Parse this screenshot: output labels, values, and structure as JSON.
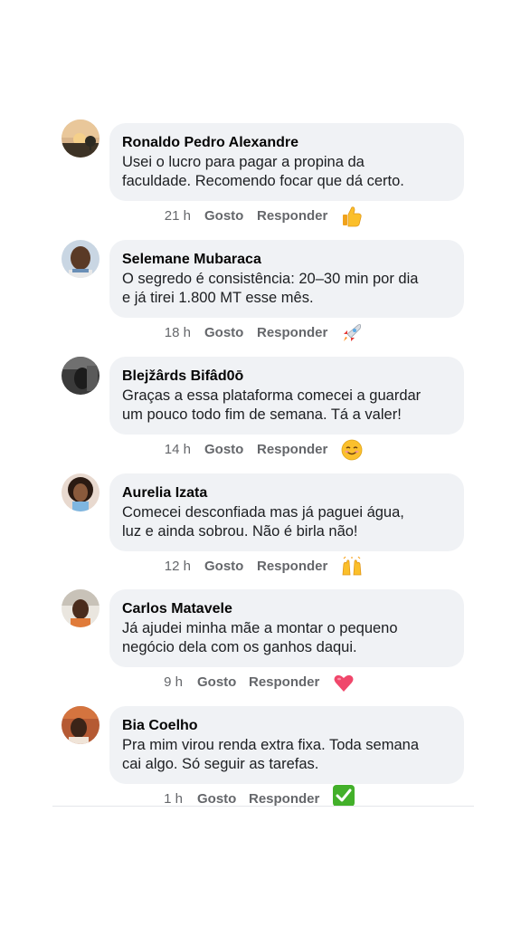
{
  "comments": [
    {
      "author": "Ronaldo Pedro Alexandre",
      "text": "Usei o lucro para pagar a propina da\nfaculdade. Recomendo focar que dá certo.",
      "time": "21 h",
      "like_label": "Gosto",
      "reply_label": "Responder",
      "reaction": "thumbs-up-icon"
    },
    {
      "author": "Selemane Mubaraca",
      "text": "O segredo é consistência: 20–30 min por dia\ne já tirei 1.800 MT esse mês.",
      "time": "18 h",
      "like_label": "Gosto",
      "reply_label": "Responder",
      "reaction": "rocket-icon"
    },
    {
      "author": "Blejžârds Bifâd0ō",
      "text": "Graças a essa plataforma comecei a guardar\num pouco todo fim de semana. Tá a valer!",
      "time": "14 h",
      "like_label": "Gosto",
      "reply_label": "Responder",
      "reaction": "smiling-face-icon"
    },
    {
      "author": "Aurelia Izata",
      "text": "Comecei desconfiada mas já paguei água,\nluz e ainda sobrou. Não é birla não!",
      "time": "12 h",
      "like_label": "Gosto",
      "reply_label": "Responder",
      "reaction": "raised-hands-icon"
    },
    {
      "author": "Carlos Matavele",
      "text": "Já ajudei minha mãe a montar o pequeno\nnegócio dela com os ganhos daqui.",
      "time": "9 h",
      "like_label": "Gosto",
      "reply_label": "Responder",
      "reaction": "red-heart-icon"
    },
    {
      "author": "Bia Coelho",
      "text": "Pra mim virou renda extra fixa. Toda semana\ncai algo. Só seguir as tarefas.",
      "time": "1 h",
      "like_label": "Gosto",
      "reply_label": "Responder",
      "reaction": "check-mark-button-icon"
    }
  ],
  "colors": {
    "bubble": "#f0f2f5",
    "name": "#050505",
    "meta": "#65676b"
  }
}
